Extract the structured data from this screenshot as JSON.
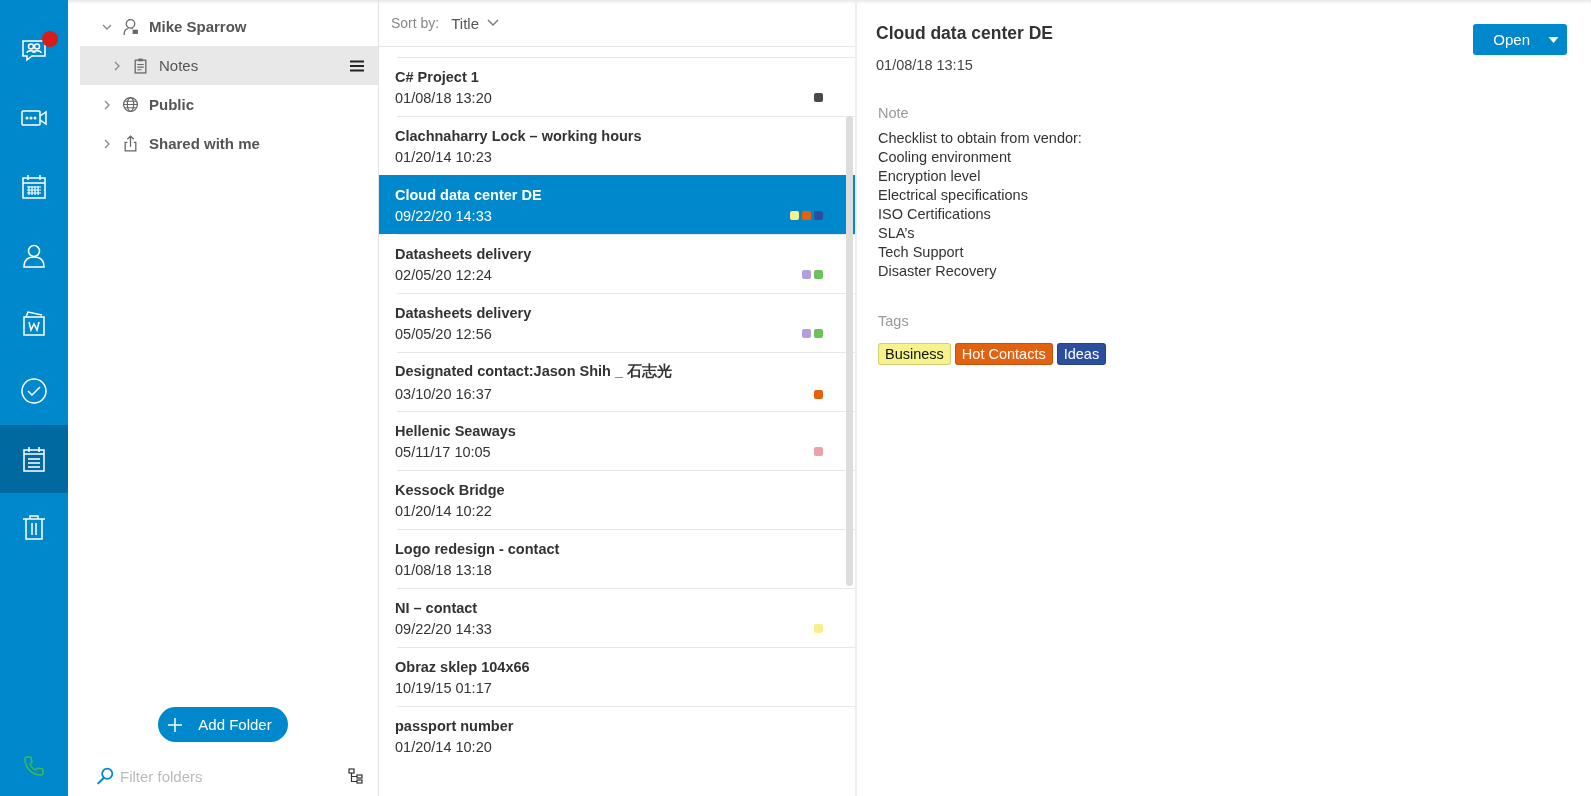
{
  "nav": [
    {
      "kind": "chat",
      "selected": false,
      "notification": true
    },
    {
      "kind": "video",
      "selected": false,
      "notification": false
    },
    {
      "kind": "calendar",
      "selected": false,
      "notification": false
    },
    {
      "kind": "contacts",
      "selected": false,
      "notification": false
    },
    {
      "kind": "documents",
      "selected": false,
      "notification": false
    },
    {
      "kind": "tasks",
      "selected": false,
      "notification": false
    },
    {
      "kind": "notes",
      "selected": true,
      "notification": false
    },
    {
      "kind": "trash",
      "selected": false,
      "notification": false
    }
  ],
  "folders": [
    {
      "label": "Mike Sparrow",
      "kind": "user",
      "expanded": true,
      "selected": false,
      "children": [
        {
          "label": "Notes",
          "kind": "notes",
          "expanded": false,
          "selected": true
        }
      ]
    },
    {
      "label": "Public",
      "kind": "globe",
      "expanded": false,
      "selected": false
    },
    {
      "label": "Shared with me",
      "kind": "share",
      "expanded": false,
      "selected": false
    }
  ],
  "add_folder": "Add Folder",
  "filter": {
    "placeholder": "Filter folders"
  },
  "sort": {
    "label": "Sort by:",
    "value": "Title"
  },
  "notes": [
    {
      "title": "C# Project 1",
      "date": "01/08/18 13:20",
      "selected": false,
      "tags": [
        {
          "color": "#4a4a4a"
        }
      ]
    },
    {
      "title": "Clachnaharry Lock – working hours",
      "date": "01/20/14 10:23",
      "selected": false
    },
    {
      "title": "Cloud data center DE",
      "date": "09/22/20 14:33",
      "selected": true,
      "tags": [
        {
          "color": "#f7f08c"
        },
        {
          "color": "#e2620f"
        },
        {
          "color": "#2b4f9e"
        }
      ]
    },
    {
      "title": "Datasheets delivery",
      "date": "02/05/20 12:24",
      "selected": false,
      "tags": [
        {
          "color": "#b59fdc"
        },
        {
          "color": "#6cc35e"
        }
      ]
    },
    {
      "title": "Datasheets delivery",
      "date": "05/05/20 12:56",
      "selected": false,
      "tags": [
        {
          "color": "#b59fdc"
        },
        {
          "color": "#6cc35e"
        }
      ]
    },
    {
      "title": "Designated contact:Jason Shih _ 石志光",
      "date": "03/10/20 16:37",
      "selected": false,
      "tags": [
        {
          "color": "#e2620f"
        }
      ]
    },
    {
      "title": "Hellenic Seaways",
      "date": "05/11/17 10:05",
      "selected": false,
      "tags": [
        {
          "color": "#e8a2a8"
        }
      ]
    },
    {
      "title": "Kessock Bridge",
      "date": "01/20/14 10:22",
      "selected": false
    },
    {
      "title": "Logo redesign - contact",
      "date": "01/08/18 13:18",
      "selected": false
    },
    {
      "title": "NI – contact",
      "date": "09/22/20 14:33",
      "selected": false,
      "tags": [
        {
          "color": "#f7f08c"
        }
      ]
    },
    {
      "title": "Obraz sklep 104x66",
      "date": "10/19/15 01:17",
      "selected": false
    },
    {
      "title": "passport number",
      "date": "01/20/14 10:20",
      "selected": false
    }
  ],
  "detail": {
    "title": "Cloud data center DE",
    "date": "01/08/18 13:15",
    "open_button": "Open",
    "note_label": "Note",
    "note_lines": [
      "Checklist to obtain from vendor:",
      "Cooling environment",
      "Encryption level",
      "Electrical specifications",
      "ISO Certifications",
      "SLA’s",
      "Tech Support",
      "Disaster Recovery"
    ],
    "tags_label": "Tags",
    "tags": [
      {
        "label": "Business",
        "color": "#f7f28c"
      },
      {
        "label": "Hot Contacts",
        "color": "#e2620f"
      },
      {
        "label": "Ideas",
        "color": "#2b4f9e"
      }
    ]
  }
}
